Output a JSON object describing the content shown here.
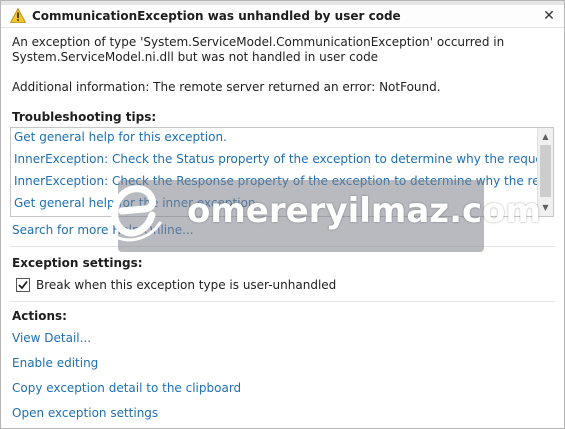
{
  "dialog": {
    "title": "CommunicationException was unhandled by user code",
    "close_glyph": "✕",
    "message_line1": "An exception of type 'System.ServiceModel.CommunicationException' occurred in",
    "message_line2": "System.ServiceModel.ni.dll but was not handled in user code",
    "additional_info": "Additional information: The remote server returned an error: NotFound."
  },
  "troubleshooting": {
    "heading": "Troubleshooting tips:",
    "tips": [
      "Get general help for this exception.",
      "InnerException: Check the Status property of the exception to determine why the request failed.",
      "InnerException: Check the Response property of the exception to determine why the request failed.",
      "Get general help for the inner exception."
    ],
    "search_link": "Search for more Help Online..."
  },
  "exception_settings": {
    "heading": "Exception settings:",
    "checkbox_label": "Break when this exception type is user-unhandled",
    "checked": true
  },
  "actions": {
    "heading": "Actions:",
    "items": [
      "View Detail...",
      "Enable editing",
      "Copy exception detail to the clipboard",
      "Open exception settings"
    ]
  },
  "watermark": {
    "text": "omereryilmaz.com"
  },
  "icons": {
    "warning": "warning-triangle-icon",
    "close": "close-icon",
    "scroll_up": "scroll-up-arrow-icon",
    "scroll_down": "scroll-down-arrow-icon",
    "checkmark": "checkmark-icon",
    "watermark_logo": "watermark-e-logo-icon"
  },
  "colors": {
    "link": "#1e6fb3",
    "warning_fill": "#f3c52b",
    "watermark_bg": "#7d828c"
  }
}
